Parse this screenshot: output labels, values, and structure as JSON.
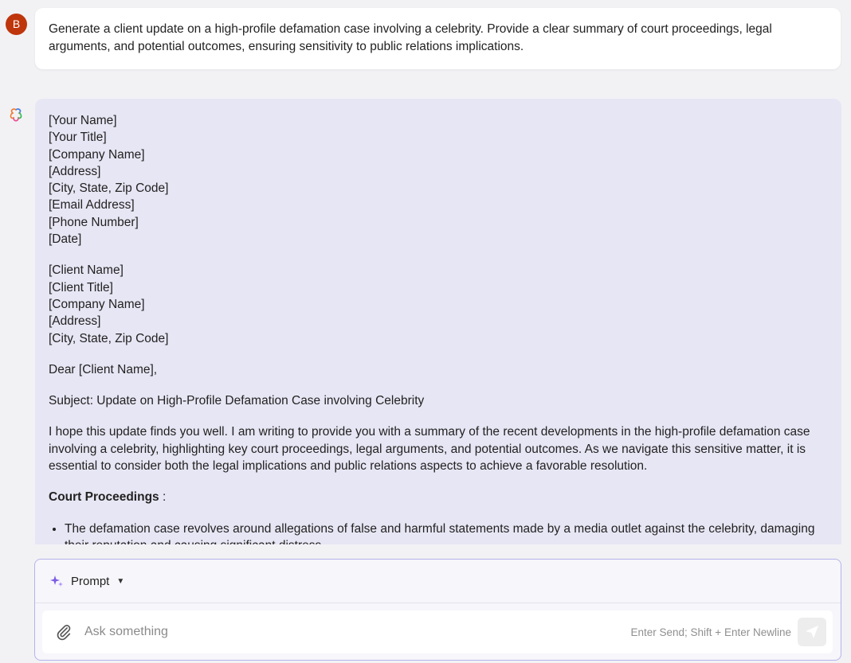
{
  "user": {
    "avatar_letter": "B",
    "message": "Generate a client update on a high-profile defamation case involving a celebrity. Provide a clear summary of court proceedings, legal arguments, and potential outcomes, ensuring sensitivity to public relations implications."
  },
  "response": {
    "sender_block": [
      "[Your Name]",
      "[Your Title]",
      "[Company Name]",
      "[Address]",
      "[City, State, Zip Code]",
      "[Email Address]",
      "[Phone Number]",
      "[Date]"
    ],
    "recipient_block": [
      "[Client Name]",
      "[Client Title]",
      "[Company Name]",
      "[Address]",
      "[City, State, Zip Code]"
    ],
    "greeting": "Dear [Client Name],",
    "subject": "Subject: Update on High-Profile Defamation Case involving Celebrity",
    "intro": "I hope this update finds you well. I am writing to provide you with a summary of the recent developments in the high-profile defamation case involving a celebrity, highlighting key court proceedings, legal arguments, and potential outcomes. As we navigate this sensitive matter, it is essential to consider both the legal implications and public relations aspects to achieve a favorable resolution.",
    "section_heading": "Court Proceedings",
    "section_colon": " :",
    "bullets": [
      "The defamation case revolves around allegations of false and harmful statements made by a media outlet against the celebrity, damaging their reputation and causing significant distress."
    ]
  },
  "composer": {
    "mode_label": "Prompt",
    "input_placeholder": "Ask something",
    "hint": "Enter Send; Shift + Enter Newline"
  },
  "icons": {
    "ai_logo": "ai-logo-icon",
    "prompt": "sparkle-icon",
    "dropdown": "caret-down-icon",
    "attach": "paperclip-icon",
    "send": "send-icon"
  },
  "colors": {
    "avatar": "#bf360c",
    "ai_bubble": "#e7e6f4",
    "composer_border": "#b6b3ea",
    "sparkle": "#7c5ce6"
  }
}
